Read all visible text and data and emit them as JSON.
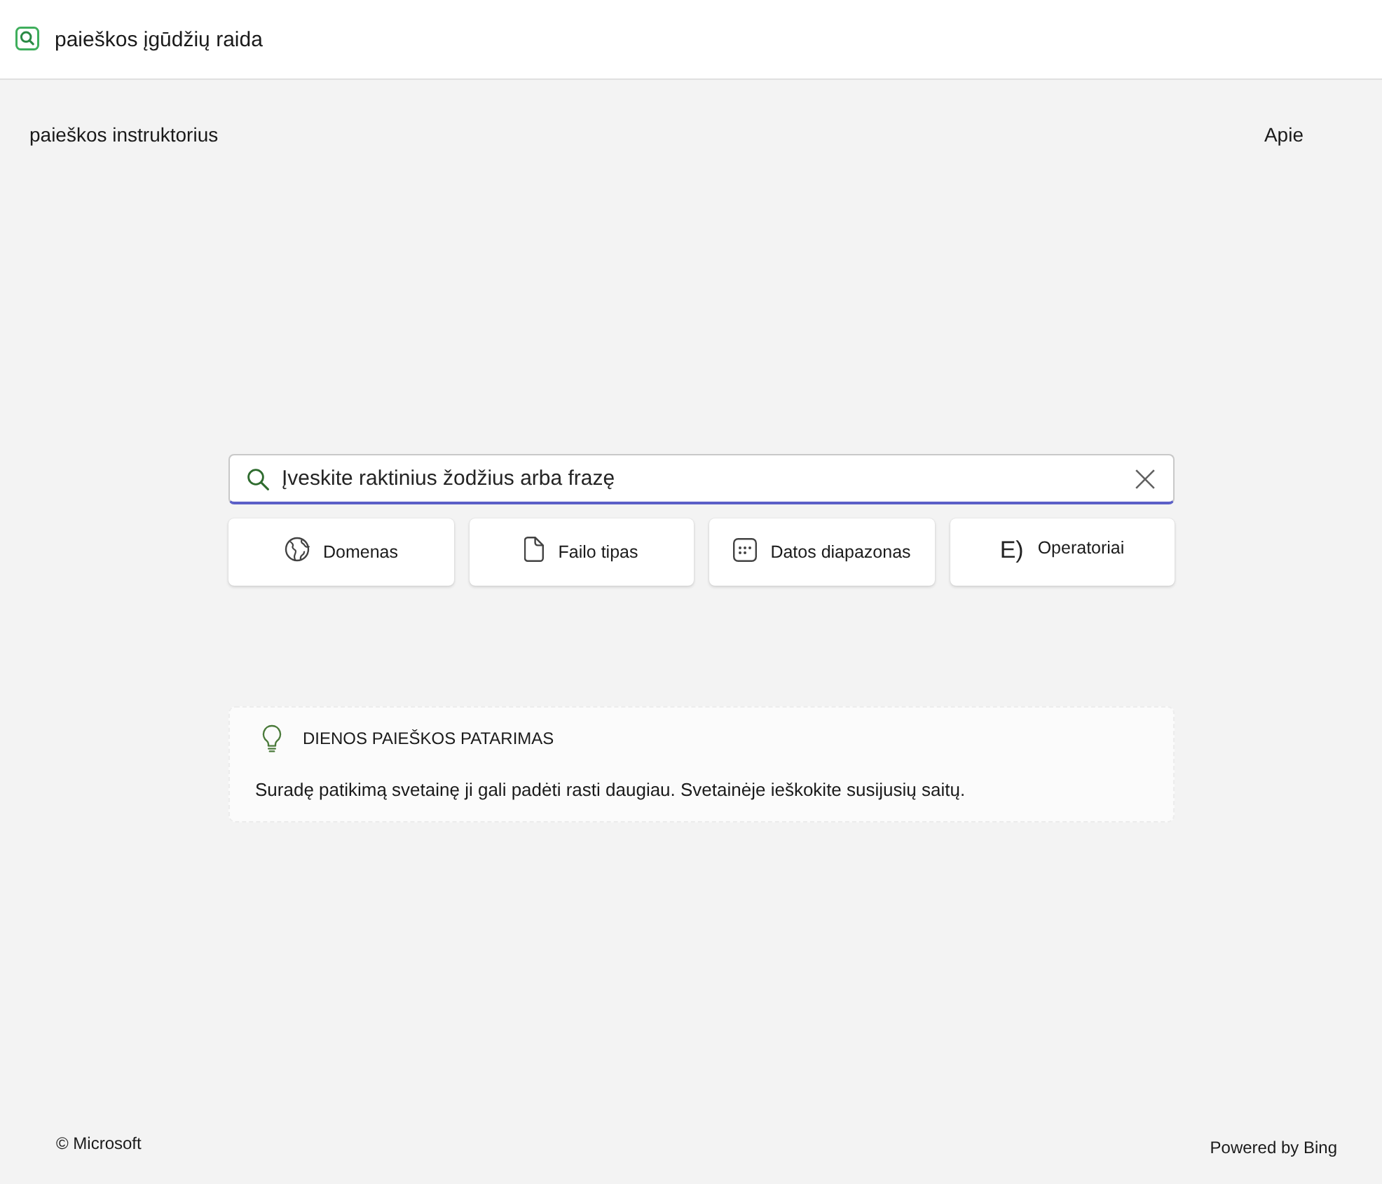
{
  "top_bar": {
    "title": "paieškos įgūdžių raida"
  },
  "header": {
    "title": "paieškos instruktorius",
    "about_link": "Apie"
  },
  "search": {
    "placeholder": "Įveskite raktinius žodžius arba frazę"
  },
  "filters": [
    {
      "kind": "domain",
      "label": "Domenas"
    },
    {
      "kind": "file_type",
      "label": "Failo tipas"
    },
    {
      "kind": "date_range",
      "label": "Datos diapazonas"
    },
    {
      "kind": "operators",
      "label": "Operatoriai",
      "icon_text": "E)"
    }
  ],
  "tip": {
    "heading": "DIENOS PAIEŠKOS PATARIMAS",
    "text": "Suradę patikimą svetainę ji gali padėti rasti daugiau. Svetainėje ieškokite susijusių saitų."
  },
  "footer": {
    "copyright": "© Microsoft",
    "powered_by": "Powered by Bing"
  }
}
